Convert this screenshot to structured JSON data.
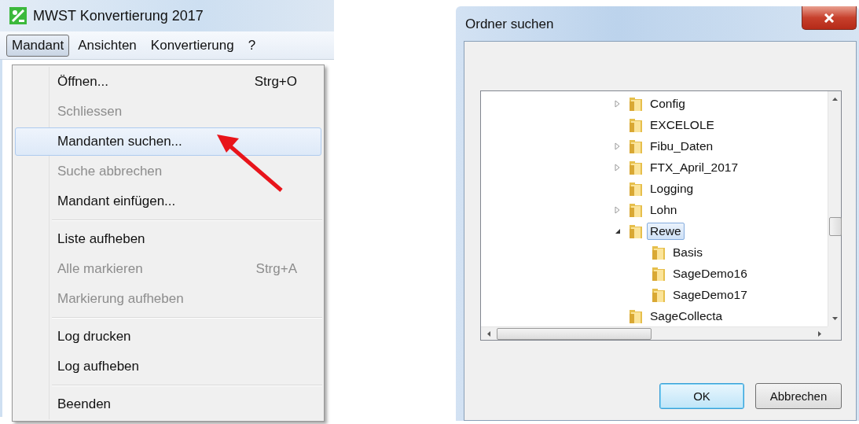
{
  "app_window": {
    "title": "MWST Konvertierung 2017",
    "menubar": [
      {
        "label": "Mandant",
        "selected": true
      },
      {
        "label": "Ansichten",
        "selected": false
      },
      {
        "label": "Konvertierung",
        "selected": false
      },
      {
        "label": "?",
        "selected": false
      }
    ],
    "menu": {
      "groups": [
        [
          {
            "label": "Öffnen...",
            "shortcut": "Strg+O",
            "disabled": false,
            "selected": false
          },
          {
            "label": "Schliessen",
            "disabled": true,
            "selected": false
          },
          {
            "label": "Mandanten suchen...",
            "disabled": false,
            "selected": true
          },
          {
            "label": "Suche abbrechen",
            "disabled": true,
            "selected": false
          },
          {
            "label": "Mandant einfügen...",
            "disabled": false,
            "selected": false
          }
        ],
        [
          {
            "label": "Liste aufheben",
            "disabled": false,
            "selected": false
          },
          {
            "label": "Alle markieren",
            "shortcut": "Strg+A",
            "disabled": true,
            "selected": false
          },
          {
            "label": "Markierung aufheben",
            "disabled": true,
            "selected": false
          }
        ],
        [
          {
            "label": "Log drucken",
            "disabled": false,
            "selected": false
          },
          {
            "label": "Log aufheben",
            "disabled": false,
            "selected": false
          }
        ],
        [
          {
            "label": "Beenden",
            "disabled": false,
            "selected": false
          }
        ]
      ]
    }
  },
  "dialog": {
    "title": "Ordner suchen",
    "tree": [
      {
        "label": "Config",
        "expanded": false,
        "selected": false
      },
      {
        "label": "EXCELOLE",
        "selected": false
      },
      {
        "label": "Fibu_Daten",
        "expanded": false,
        "selected": false
      },
      {
        "label": "FTX_April_2017",
        "expanded": false,
        "selected": false
      },
      {
        "label": "Logging",
        "selected": false
      },
      {
        "label": "Lohn",
        "expanded": false,
        "selected": false
      },
      {
        "label": "Rewe",
        "expanded": true,
        "selected": true,
        "children": [
          {
            "label": "Basis",
            "selected": false
          },
          {
            "label": "SageDemo16",
            "selected": false
          },
          {
            "label": "SageDemo17",
            "selected": false
          }
        ]
      },
      {
        "label": "SageCollecta",
        "selected": false
      }
    ],
    "buttons": [
      {
        "label": "OK",
        "kind": "default"
      },
      {
        "label": "Abbrechen",
        "kind": "normal"
      }
    ]
  }
}
